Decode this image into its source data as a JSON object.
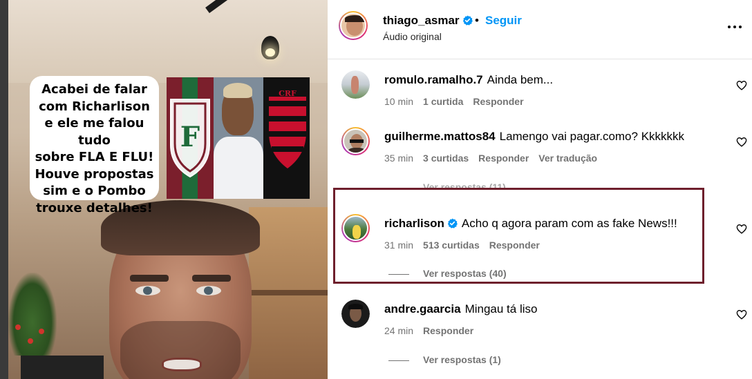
{
  "video": {
    "caption_lines": [
      "Acabei de falar",
      "com Richarlison",
      "e ele me falou tudo",
      "sobre FLA E FLU!",
      "Houve propostas",
      "sim e o Pombo",
      "trouxe detalhes!"
    ]
  },
  "header": {
    "username": "thiago_asmar",
    "separator": "•",
    "follow_label": "Seguir",
    "audio_label": "Áudio original",
    "more_icon": "more-options-icon"
  },
  "comments": [
    {
      "username": "romulo.ramalho.7",
      "text": "Ainda bem...",
      "time": "10 min",
      "likes": "1 curtida",
      "reply_label": "Responder",
      "translate_label": "",
      "verified": false
    },
    {
      "username": "guilherme.mattos84",
      "text": "Lamengo vai pagar.como? Kkkkkkk",
      "time": "35 min",
      "likes": "3 curtidas",
      "reply_label": "Responder",
      "translate_label": "Ver tradução",
      "verified": false
    },
    {
      "username": "richarlison",
      "text": "Acho q agora param com as fake News!!!",
      "time": "31 min",
      "likes": "513 curtidas",
      "reply_label": "Responder",
      "translate_label": "",
      "verified": true
    },
    {
      "username": "andre.gaarcia",
      "text": "Mingau tá liso",
      "time": "24 min",
      "likes": "",
      "reply_label": "Responder",
      "translate_label": "",
      "verified": false
    }
  ],
  "replies": {
    "partial": "Ver respostas (11)",
    "richarlison": "Ver respostas (40)",
    "andre": "Ver respostas (1)"
  },
  "colors": {
    "follow_blue": "#0095f6",
    "verified_blue": "#0095f6",
    "highlight_border": "#6e1f2c",
    "meta_gray": "#737373"
  }
}
